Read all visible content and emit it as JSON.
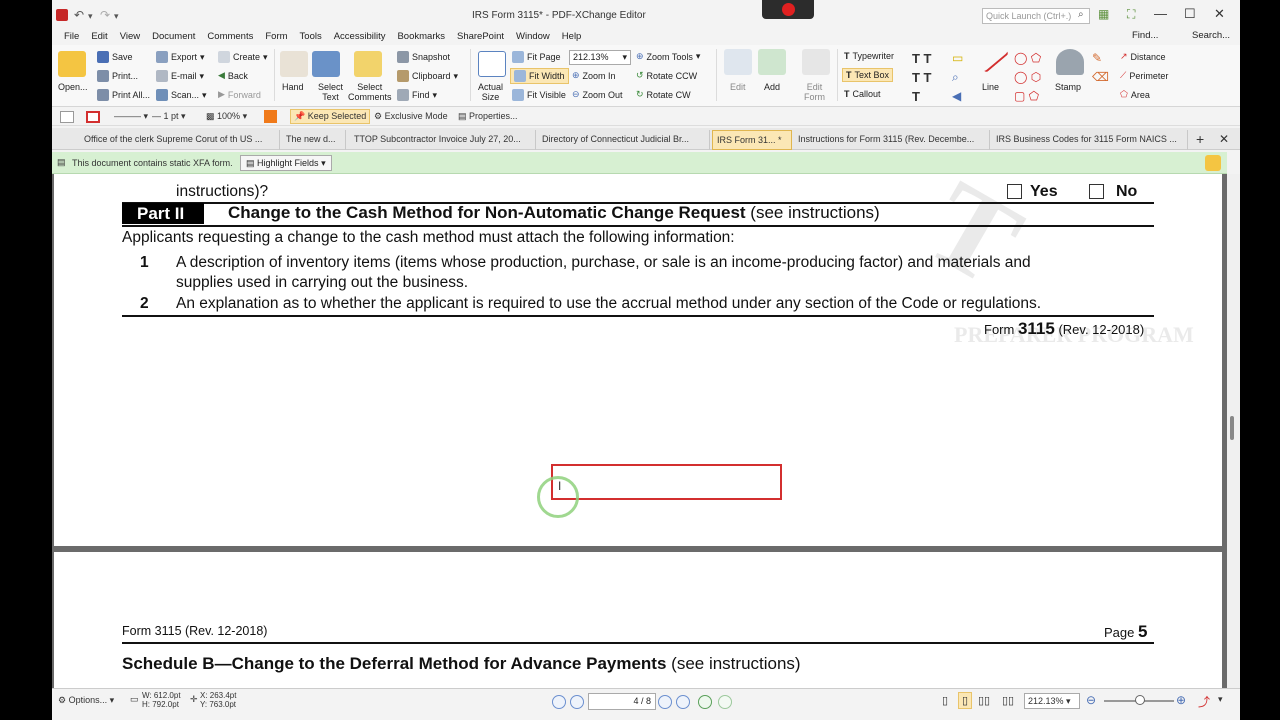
{
  "window": {
    "title": "IRS Form 3115* - PDF-XChange Editor",
    "quick_launch_placeholder": "Quick Launch (Ctrl+.)"
  },
  "menu": [
    "File",
    "Edit",
    "View",
    "Document",
    "Comments",
    "Form",
    "Tools",
    "Accessibility",
    "Bookmarks",
    "SharePoint",
    "Window",
    "Help"
  ],
  "menu_right": {
    "find": "Find...",
    "search": "Search..."
  },
  "ribbon": {
    "open": "Open...",
    "save": "Save",
    "print": "Print...",
    "print_all": "Print All...",
    "export": "Export",
    "email": "E-mail",
    "scan": "Scan...",
    "create": "Create",
    "back": "Back",
    "forward": "Forward",
    "hand": "Hand",
    "select_text": "Select\nText",
    "select_comments": "Select\nComments",
    "snapshot": "Snapshot",
    "clipboard": "Clipboard",
    "find": "Find",
    "actual_size": "Actual\nSize",
    "fit_page": "Fit Page",
    "fit_width": "Fit Width",
    "fit_visible": "Fit Visible",
    "zoom_value": "212.13%",
    "zoom_tools": "Zoom Tools",
    "zoom_in": "Zoom In",
    "zoom_out": "Zoom Out",
    "rotate_ccw": "Rotate CCW",
    "rotate_cw": "Rotate CW",
    "edit": "Edit",
    "add": "Add",
    "edit_form": "Edit\nForm",
    "typewriter": "Typewriter",
    "text_box": "Text Box",
    "callout": "Callout",
    "line": "Line",
    "stamp": "Stamp",
    "distance": "Distance",
    "perimeter": "Perimeter",
    "area": "Area"
  },
  "prop_toolbar": {
    "line_width": "1 pt",
    "opacity": "100%",
    "keep_selected": "Keep Selected",
    "exclusive_mode": "Exclusive Mode",
    "properties": "Properties..."
  },
  "tabs": [
    "Office of the clerk Supreme Corut of th US ...",
    "The new d...",
    "TTOP Subcontractor Invoice July 27, 20...",
    "Directory of Connecticut Judicial Br...",
    "IRS Form 31... *",
    "Instructions for Form 3115 (Rev. Decembe...",
    "IRS Business Codes for 3115 Form NAICS ..."
  ],
  "infobar": {
    "message": "This document contains static XFA form.",
    "highlight_button": "Highlight Fields"
  },
  "page1": {
    "cut_line": "instructions)?",
    "yes": "Yes",
    "no": "No",
    "part_label": "Part II",
    "part_title": "Change to the Cash Method for Non-Automatic Change Request",
    "part_title_suffix": " (see instructions)",
    "intro": "Applicants requesting a change to the cash method must attach the following information:",
    "items": [
      {
        "num": "1",
        "line1": "A description of inventory items (items whose production, purchase, or sale is an income-producing factor) and materials  and",
        "line2": "supplies used in carrying out the business."
      },
      {
        "num": "2",
        "line1": "An explanation as to whether the applicant is required to use the accrual method under any section of the Code or regulations.",
        "line2": ""
      }
    ],
    "footer_form": "Form ",
    "footer_num": "3115",
    "footer_rev": " (Rev. 12-2018)"
  },
  "page2": {
    "header_left": "Form 3115 (Rev. 12-2018)",
    "header_page_label": "Page ",
    "header_page_num": "5",
    "schedule_title": "Schedule B—Change to the Deferral Method for Advance Payments",
    "schedule_suffix": " (see instructions)"
  },
  "statusbar": {
    "options": "Options...",
    "width": "W: 612.0pt",
    "height": "H: 792.0pt",
    "x": "X: 263.4pt",
    "y": "Y: 763.0pt",
    "page_display": "4 / 8",
    "zoom": "212.13%"
  },
  "colors": {
    "accent_red": "#d32f2f",
    "info_green": "#d7f0d2",
    "active_tab": "#fbe7b5"
  }
}
